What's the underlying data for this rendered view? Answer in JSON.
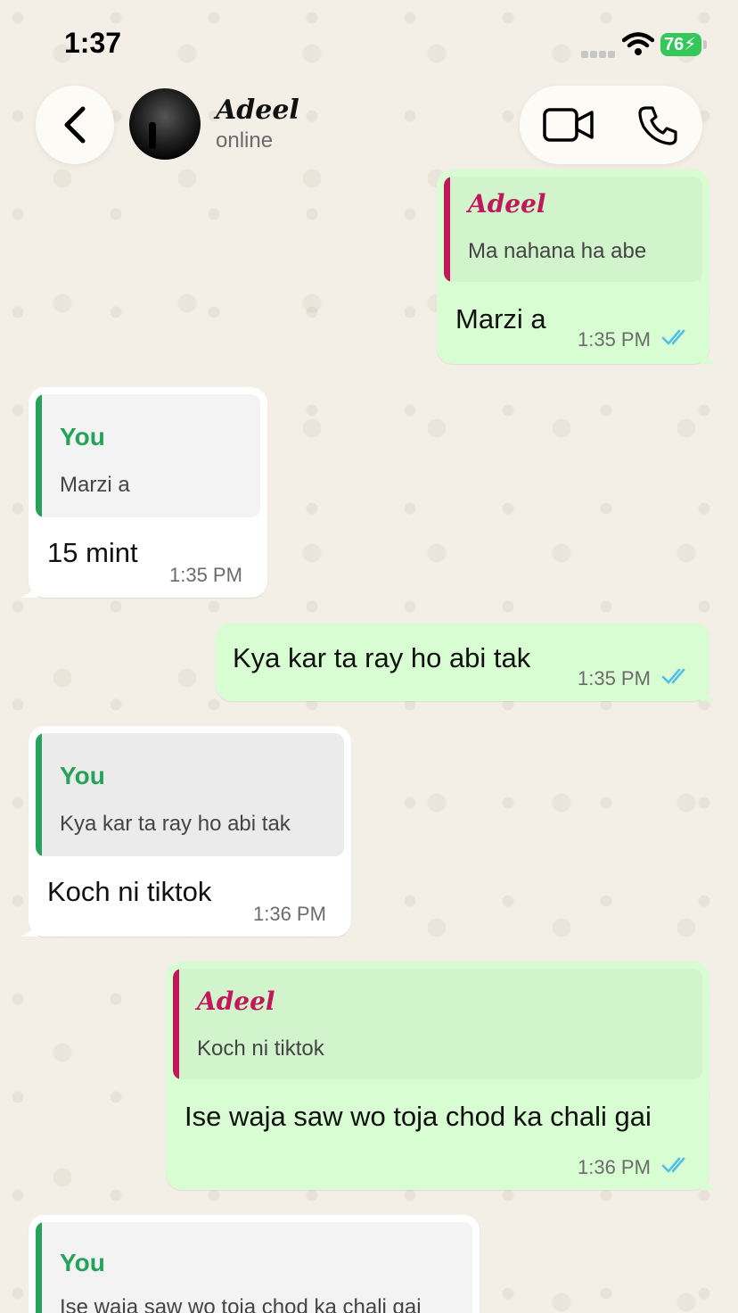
{
  "status_bar": {
    "time": "1:37",
    "battery": "76"
  },
  "header": {
    "contact_name": "Adeel",
    "contact_status": "online"
  },
  "colors": {
    "outgoing_bubble": "#d9fdd3",
    "incoming_bubble": "#ffffff",
    "you_accent": "#25a35a",
    "adeel_accent": "#c2185b",
    "read_ticks": "#53bdeb"
  },
  "messages": [
    {
      "direction": "out",
      "quote_author": "Adeel",
      "quote_text": "Ma nahana ha abe",
      "text": "Marzi a",
      "time": "1:35 PM",
      "read": true
    },
    {
      "direction": "in",
      "quote_author": "You",
      "quote_text": "Marzi a",
      "text": "15 mint",
      "time": "1:35 PM"
    },
    {
      "direction": "out",
      "text": "Kya kar ta ray ho abi tak",
      "time": "1:35 PM",
      "read": true
    },
    {
      "direction": "in",
      "quote_author": "You",
      "quote_text": "Kya kar ta ray ho abi tak",
      "text": "Koch ni tiktok",
      "time": "1:36 PM"
    },
    {
      "direction": "out",
      "quote_author": "Adeel",
      "quote_text": "Koch ni tiktok",
      "text": "Ise waja saw wo toja chod ka chali gai",
      "time": "1:36 PM",
      "read": true
    },
    {
      "direction": "in",
      "quote_author": "You",
      "quote_text": "Ise waja saw wo toja chod ka chali gai"
    }
  ]
}
